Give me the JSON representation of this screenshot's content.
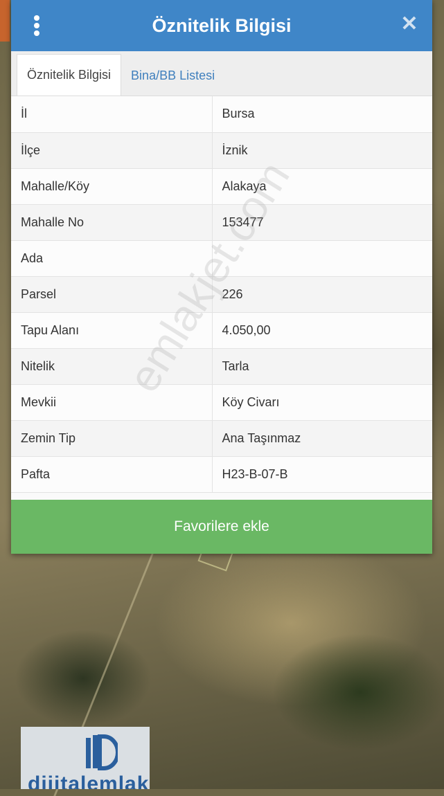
{
  "header": {
    "title": "Öznitelik Bilgisi",
    "menu_icon": "more-vertical-icon",
    "close_icon": "close-icon"
  },
  "tabs": [
    {
      "label": "Öznitelik Bilgisi",
      "active": true
    },
    {
      "label": "Bina/BB Listesi",
      "active": false
    }
  ],
  "attributes": [
    {
      "key": "İl",
      "value": "Bursa"
    },
    {
      "key": "İlçe",
      "value": "İznik"
    },
    {
      "key": "Mahalle/Köy",
      "value": "Alakaya"
    },
    {
      "key": "Mahalle No",
      "value": "153477"
    },
    {
      "key": "Ada",
      "value": ""
    },
    {
      "key": "Parsel",
      "value": "226"
    },
    {
      "key": "Tapu Alanı",
      "value": "4.050,00"
    },
    {
      "key": "Nitelik",
      "value": "Tarla"
    },
    {
      "key": "Mevkii",
      "value": "Köy Civarı"
    },
    {
      "key": "Zemin Tip",
      "value": "Ana Taşınmaz"
    },
    {
      "key": "Pafta",
      "value": "H23-B-07-B"
    }
  ],
  "favorite_button": {
    "label": "Favorilere ekle"
  },
  "watermark": "emlakjet.com",
  "logo": {
    "text": "dijitalemlak"
  },
  "colors": {
    "header": "#3f86c8",
    "button": "#6ab864",
    "tab_link": "#3f7fbd"
  }
}
